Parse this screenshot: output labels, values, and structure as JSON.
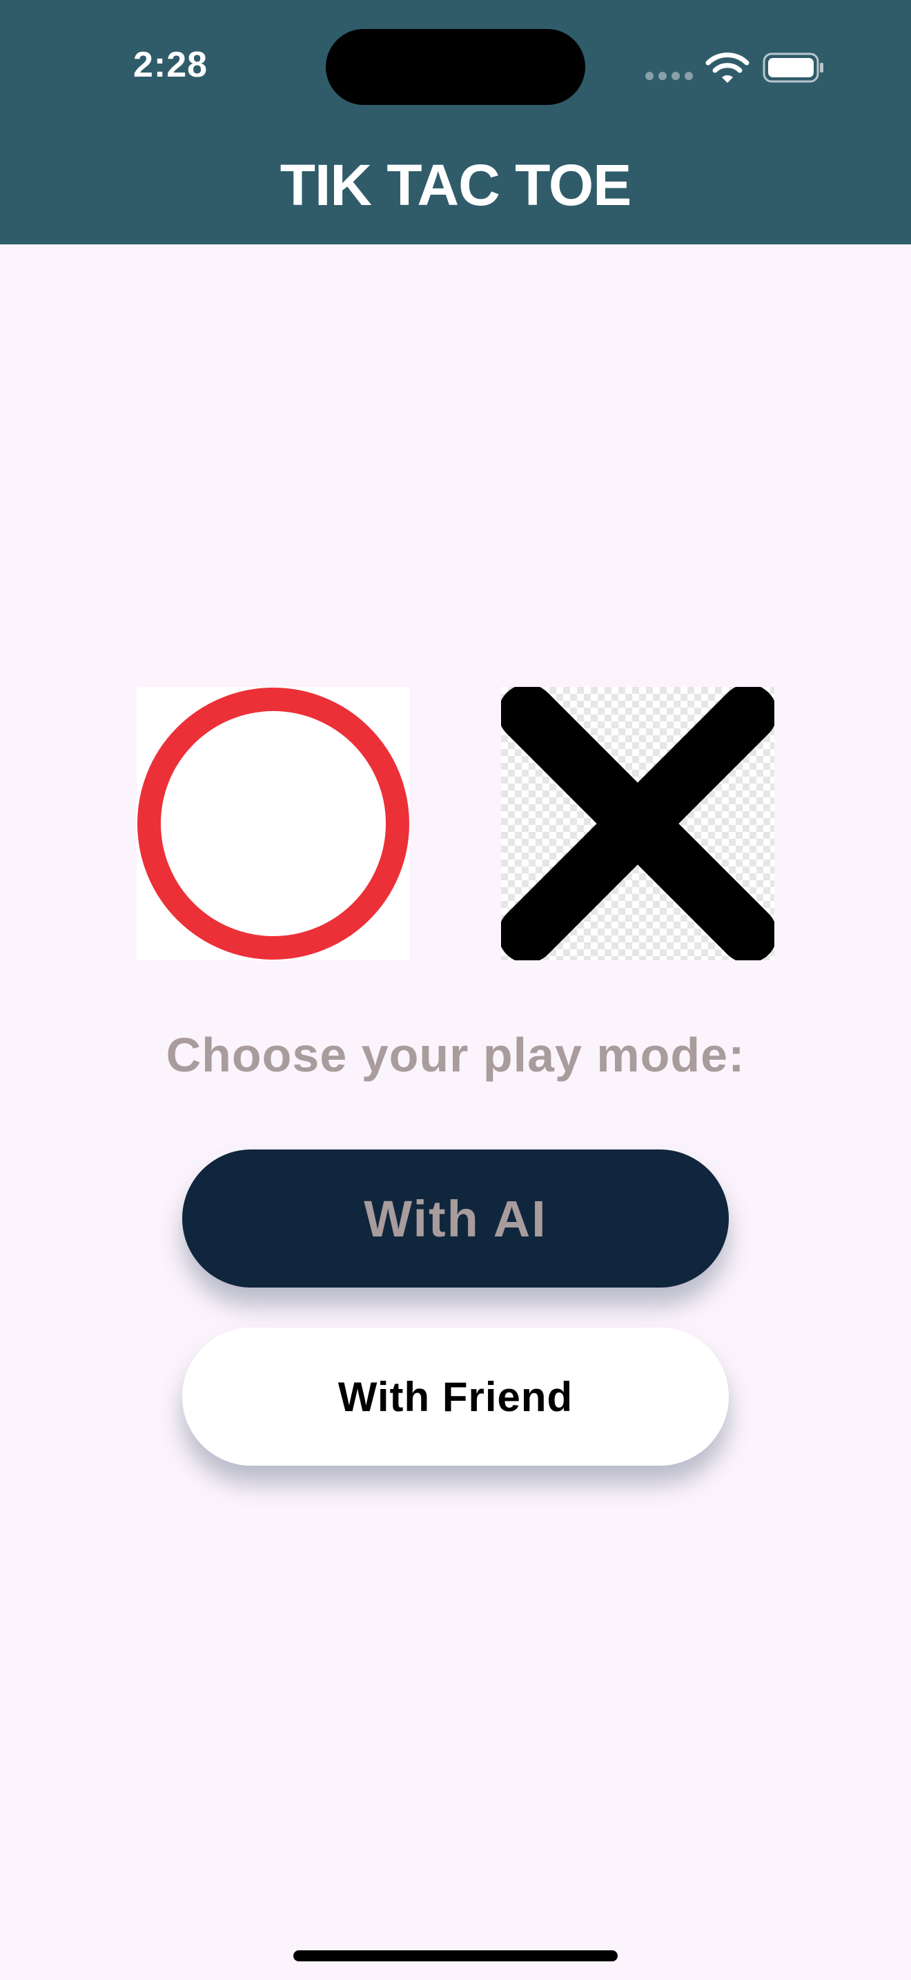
{
  "status_bar": {
    "time": "2:28",
    "icons": [
      "signal-icon",
      "wifi-icon",
      "battery-icon"
    ]
  },
  "header": {
    "title": "TIK TAC TOE",
    "background_color": "#305c6a"
  },
  "symbols": {
    "o_icon": "o-mark-icon",
    "o_color": "#ec3038",
    "x_icon": "x-mark-icon",
    "x_color": "#000000"
  },
  "main": {
    "prompt": "Choose your play mode:",
    "buttons": {
      "with_ai": "With AI",
      "with_friend": "With Friend"
    }
  },
  "colors": {
    "background": "#fcf4fc",
    "ai_button": "#10263d",
    "friend_button": "#ffffff",
    "muted_text": "#a89c9c"
  }
}
